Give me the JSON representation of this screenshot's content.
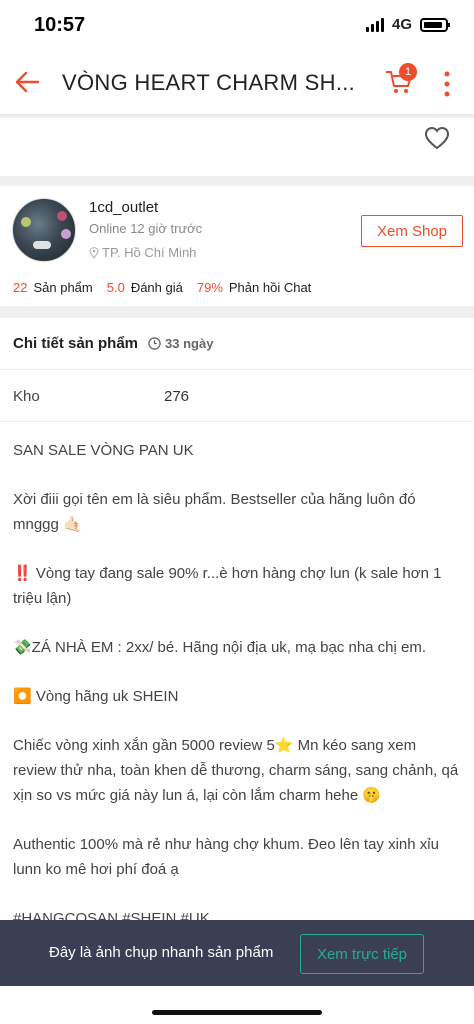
{
  "status_bar": {
    "time": "10:57",
    "network": "4G"
  },
  "header": {
    "title": "VÒNG HEART CHARM SH...",
    "cart_count": "1"
  },
  "shop": {
    "name": "1cd_outlet",
    "online": "Online 12 giờ trước",
    "location": "TP. Hồ Chí Minh",
    "view_button": "Xem Shop",
    "stats": [
      {
        "value": "22",
        "label": "Sản phẩm"
      },
      {
        "value": "5.0",
        "label": "Đánh giá"
      },
      {
        "value": "79%",
        "label": "Phản hồi Chat"
      }
    ]
  },
  "detail": {
    "title": "Chi tiết sản phẩm",
    "age": "33 ngày",
    "stock_label": "Kho",
    "stock_value": "276",
    "paragraphs": [
      "SAN SALE VÒNG PAN UK",
      "Xời điii gọi tên em là siêu phẩm. Bestseller của hãng luôn đó mnggg 🤙🏻",
      "‼️ Vòng tay đang sale 90% r...è hơn hàng chợ lun (k sale hơn 1 triệu lận)",
      "💸ZÁ NHÀ EM : 2xx/ bé. Hãng nội địa uk, mạ bạc nha chị em.",
      "⏺️ Vòng hãng uk SHEIN",
      "Chiếc vòng xinh xắn gần 5000 review 5⭐ Mn kéo sang xem review thử nha, toàn khen dễ thương, charm sáng, sang chảnh, qá xịn so vs mức giá này lun á, lại còn lắm charm hehe 🤫",
      "Authentic 100% mà rẻ như hàng chợ khum. Đeo lên tay xinh xỉu lunn ko mê hơi phí đoá ạ",
      "#HANGCOSAN #SHEIN #UK"
    ]
  },
  "snapshot": {
    "text": "Đây là ảnh chụp nhanh sản phẩm",
    "button": "Xem trực tiếp"
  },
  "colors": {
    "accent": "#ee4d2d",
    "teal": "#26aa99",
    "snapshot_bg": "#3a3f55"
  },
  "icons": [
    "back-arrow-icon",
    "cart-icon",
    "more-icon",
    "heart-icon",
    "location-pin-icon",
    "clock-icon"
  ]
}
